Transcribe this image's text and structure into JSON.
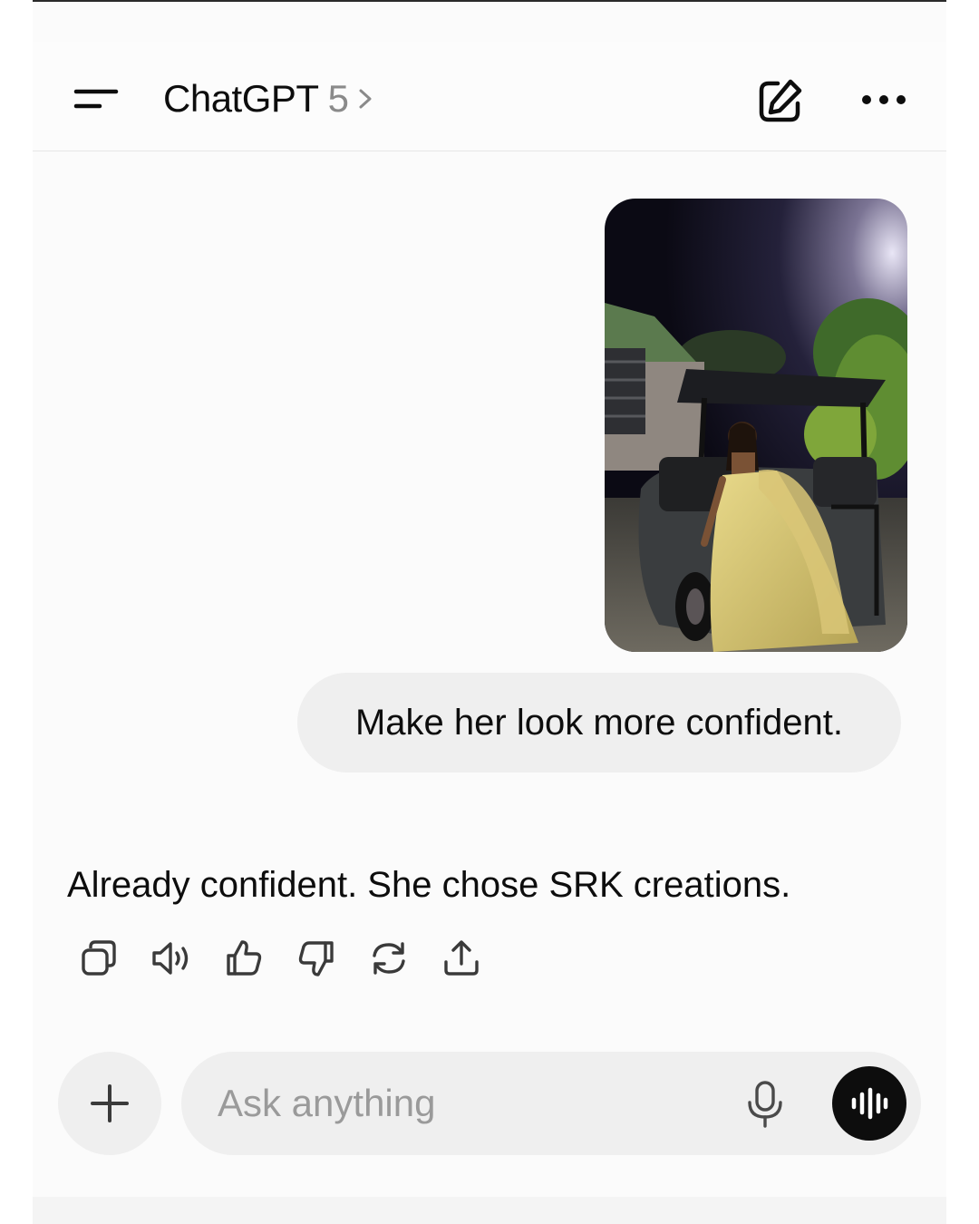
{
  "header": {
    "title": "ChatGPT",
    "model_version": "5",
    "menu_icon": "menu-lines-icon",
    "edit_icon": "new-chat-pencil-icon",
    "more_icon": "ellipsis-icon"
  },
  "conversation": {
    "user_message": "Make her look more confident.",
    "assistant_message": "Already confident. She chose SRK creations.",
    "assistant_actions": [
      {
        "icon": "copy-icon"
      },
      {
        "icon": "read-aloud-icon"
      },
      {
        "icon": "thumbs-up-icon"
      },
      {
        "icon": "thumbs-down-icon"
      },
      {
        "icon": "regenerate-icon"
      },
      {
        "icon": "share-icon"
      }
    ]
  },
  "composer": {
    "placeholder": "Ask anything",
    "value": "",
    "plus_icon": "plus-icon",
    "mic_icon": "microphone-icon",
    "voice_icon": "voice-mode-waveform-icon"
  },
  "colors": {
    "background": "#fbfbfb",
    "bubble": "#efefef",
    "text": "#0d0d0d",
    "muted": "#8a8a8a",
    "voice_button": "#0d0d0d"
  }
}
